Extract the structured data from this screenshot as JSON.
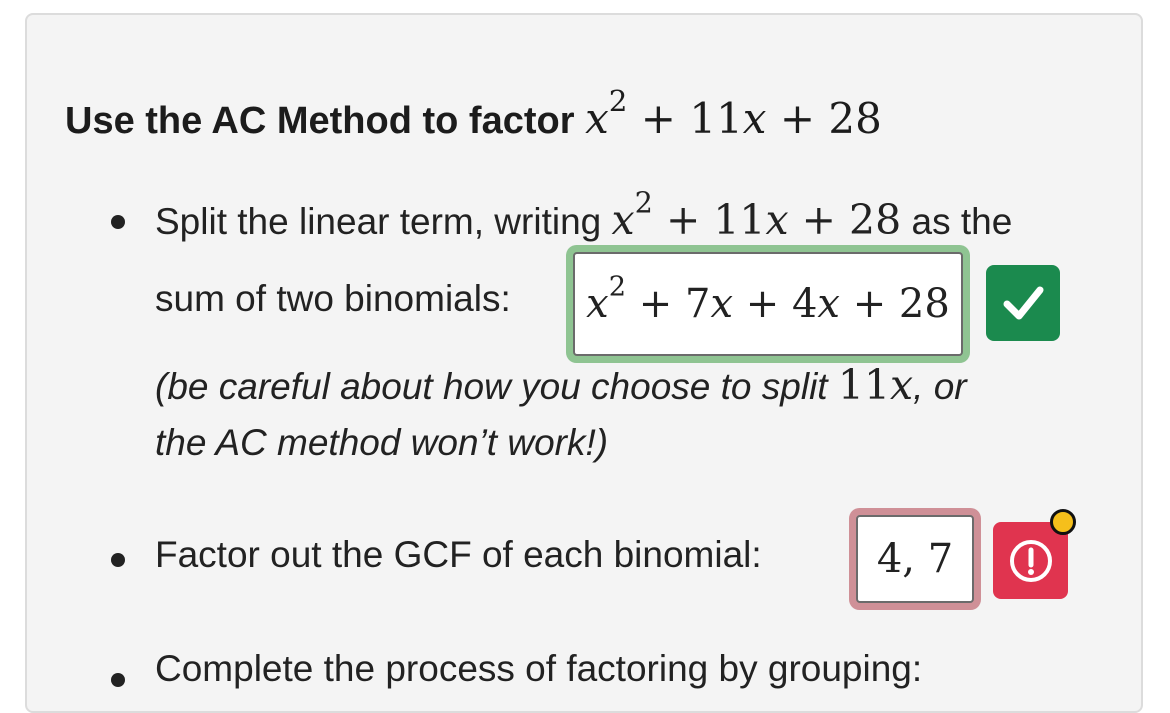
{
  "problem": {
    "title_prefix": "Use the AC Method to factor",
    "expression": "x² + 11x + 28"
  },
  "steps": [
    {
      "text_before": "Split the linear term, writing",
      "text_after": "as the",
      "line2_label": "sum of two binomials:",
      "answer": "x² + 7x + 4x + 28",
      "status": "correct",
      "hint_before": "(be careful about how you choose to split",
      "hint_term": "11x",
      "hint_after": ", or",
      "hint_line2": "the AC method won’t work!)"
    },
    {
      "text": "Factor out the GCF of each binomial:",
      "answer": "4, 7",
      "status": "incorrect"
    },
    {
      "text": "Complete the process of factoring by grouping:"
    }
  ],
  "icons": {
    "correct": "check-icon",
    "incorrect": "exclamation-circle-icon",
    "notification": "notification-dot"
  },
  "colors": {
    "correct_green": "#1b8a4e",
    "correct_glow": "#8fc492",
    "incorrect_red": "#e0344f",
    "incorrect_glow": "#cf9097",
    "notification_yellow": "#f5bf1b"
  }
}
